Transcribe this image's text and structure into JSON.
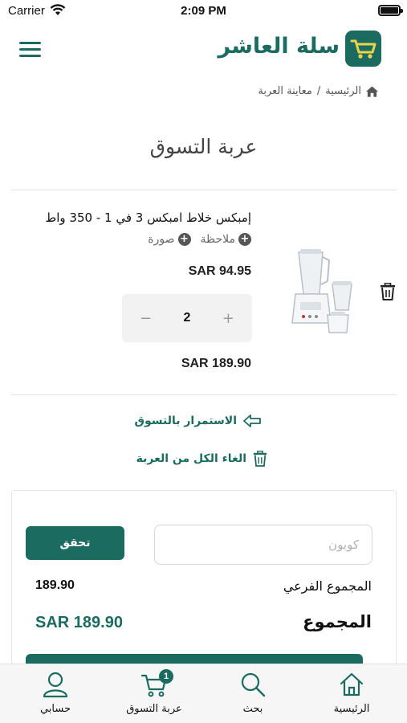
{
  "status_bar": {
    "carrier": "Carrier",
    "time": "2:09 PM"
  },
  "header": {
    "brand": "سلة العاشر",
    "logo_icon": "shopping-basket-icon",
    "menu_icon": "hamburger-menu-icon"
  },
  "breadcrumb": {
    "home": "الرئيسية",
    "separator": "/",
    "current": "معاينة العربة"
  },
  "page_title": "عربة التسوق",
  "cart_item": {
    "name": "إمبكس خلاط امبكس 3 في 1 - 350 واط",
    "note_label": "ملاحظة",
    "image_label": "صورة",
    "unit_price": "SAR 94.95",
    "quantity": "2",
    "minus": "−",
    "plus": "+",
    "line_total": "SAR 189.90"
  },
  "actions": {
    "continue_shopping": "الاستمرار بالتسوق",
    "clear_all": "الغاء الكل من العربة"
  },
  "summary": {
    "coupon_placeholder": "كوبون",
    "check_button": "تحقق",
    "subtotal_label": "المجموع الفرعي",
    "subtotal_value": "189.90",
    "total_label": "المجموع",
    "total_value": "SAR 189.90"
  },
  "tabbar": {
    "home": "الرئيسية",
    "search": "بحث",
    "cart": "عربة التسوق",
    "cart_badge": "1",
    "account": "حسابي"
  },
  "colors": {
    "brand": "#1c6b60",
    "background": "#ffffff",
    "tabbar": "#f6f6f6"
  }
}
